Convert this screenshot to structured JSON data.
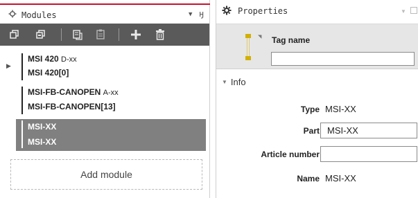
{
  "modules_panel": {
    "title": "Modules",
    "toolbar": {
      "buttons": [
        "collapse-all-icon",
        "expand-all-icon",
        "copy-icon",
        "paste-icon",
        "add-icon",
        "delete-icon"
      ]
    },
    "items": [
      {
        "line1_bold": "MSI 420",
        "line1_suffix": "D-xx",
        "line2": "MSI 420[0]",
        "expandable": true,
        "selected": false
      },
      {
        "line1_bold": "MSI-FB-CANOPEN",
        "line1_suffix": "A-xx",
        "line2": "MSI-FB-CANOPEN[13]",
        "expandable": false,
        "selected": false
      },
      {
        "line1_bold": "MSI-XX",
        "line1_suffix": "",
        "line2": "MSI-XX",
        "expandable": false,
        "selected": true
      }
    ],
    "add_module_label": "Add module"
  },
  "properties_panel": {
    "title": "Properties",
    "tag_name_label": "Tag name",
    "tag_name_value": "",
    "section_title": "Info",
    "fields": {
      "type_label": "Type",
      "type_value": "MSI-XX",
      "part_label": "Part",
      "part_value": "MSI-XX",
      "article_label": "Article number",
      "article_value": "",
      "name_label": "Name",
      "name_value": "MSI-XX"
    }
  },
  "colors": {
    "accent": "#c8102e",
    "toolbar": "#5a5a5a",
    "selection": "#808080",
    "tag_area": "#e6e6e6"
  }
}
